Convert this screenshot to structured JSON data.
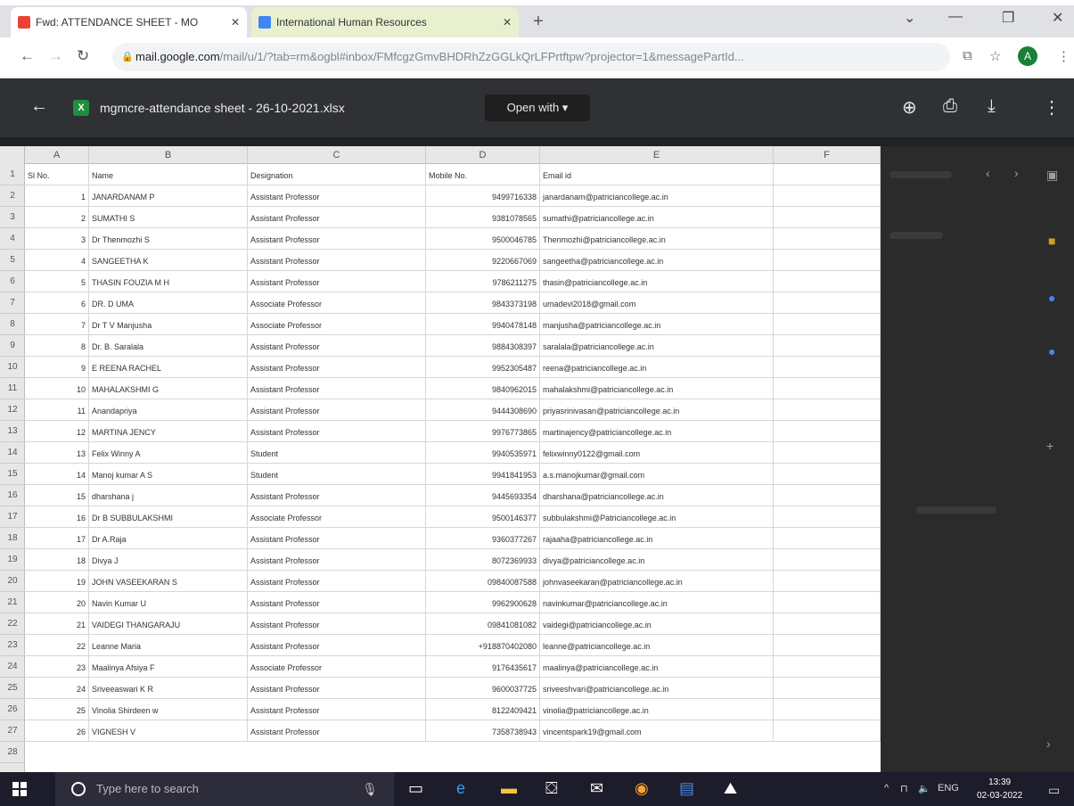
{
  "browser": {
    "tabs": [
      {
        "title": "Fwd: ATTENDANCE SHEET - MO",
        "close": "✕",
        "favicon_color": "#c5221f"
      },
      {
        "title": "International Human Resources",
        "close": "✕",
        "favicon_color": "#1a73e8"
      }
    ],
    "new_tab": "+",
    "url_host": "mail.google.com",
    "url_path": "/mail/u/1/?tab=rm&ogbl#inbox/FMfcgzGmvBHDRhZzGGLkQrLFPrtftpw?projector=1&messagePartId...",
    "avatar_letter": "A"
  },
  "viewer": {
    "file_name": "mgmcre-attendance sheet - 26-10-2021.xlsx",
    "file_icon_letter": "X",
    "open_with_label": "Open with ▾"
  },
  "sheet": {
    "columns": [
      "A",
      "B",
      "C",
      "D",
      "E",
      "F"
    ],
    "row_numbers": [
      "1",
      "2",
      "3",
      "4",
      "5",
      "6",
      "7",
      "8",
      "9",
      "10",
      "11",
      "12",
      "13",
      "14",
      "15",
      "16",
      "17",
      "18",
      "19",
      "20",
      "21",
      "22",
      "23",
      "24",
      "25",
      "26",
      "27",
      "28"
    ],
    "header": {
      "sl": "Sl No.",
      "name": "Name",
      "designation": "Designation",
      "mobile": "Mobile No.",
      "email": "Email id",
      "f": ""
    },
    "rows": [
      {
        "sl": "1",
        "name": "JANARDANAM P",
        "designation": "Assistant Professor",
        "mobile": "9499716338",
        "email": "janardanam@patriciancollege.ac.in"
      },
      {
        "sl": "2",
        "name": "SUMATHI S",
        "designation": "Assistant Professor",
        "mobile": "9381078565",
        "email": "sumathi@patriciancollege.ac.in"
      },
      {
        "sl": "3",
        "name": "Dr Thenmozhi S",
        "designation": "Assistant Professor",
        "mobile": "9500046785",
        "email": "Thenmozhi@patriciancollege.ac.in"
      },
      {
        "sl": "4",
        "name": "SANGEETHA K",
        "designation": "Assistant Professor",
        "mobile": "9220667069",
        "email": "sangeetha@patriciancollege.ac.in"
      },
      {
        "sl": "5",
        "name": "THASIN FOUZIA M H",
        "designation": "Assistant Professor",
        "mobile": "9786211275",
        "email": "thasin@patriciancollege.ac.in"
      },
      {
        "sl": "6",
        "name": "DR. D UMA",
        "designation": "Associate Professor",
        "mobile": "9843373198",
        "email": "umadevi2018@gmail.com"
      },
      {
        "sl": "7",
        "name": "Dr T V Manjusha",
        "designation": "Associate Professor",
        "mobile": "9940478148",
        "email": "manjusha@patriciancollege.ac.in"
      },
      {
        "sl": "8",
        "name": "Dr. B. Saralala",
        "designation": "Assistant Professor",
        "mobile": "9884308397",
        "email": "saralala@patriciancollege.ac.in"
      },
      {
        "sl": "9",
        "name": "E REENA RACHEL",
        "designation": "Assistant Professor",
        "mobile": "9952305487",
        "email": "reena@patriciancollege.ac.in"
      },
      {
        "sl": "10",
        "name": "MAHALAKSHMI G",
        "designation": "Assistant Professor",
        "mobile": "9840962015",
        "email": "mahalakshmi@patriciancollege.ac.in"
      },
      {
        "sl": "11",
        "name": "Anandapriya",
        "designation": "Assistant Professor",
        "mobile": "9444308690",
        "email": "priyasrinivasan@patriciancollege.ac.in"
      },
      {
        "sl": "12",
        "name": "MARTINA JENCY",
        "designation": "Assistant Professor",
        "mobile": "9976773865",
        "email": "martinajency@patriciancollege.ac.in"
      },
      {
        "sl": "13",
        "name": "Felix Winny A",
        "designation": "Student",
        "mobile": "9940535971",
        "email": "felixwinny0122@gmail.com"
      },
      {
        "sl": "14",
        "name": "Manoj kumar A S",
        "designation": "Student",
        "mobile": "9941841953",
        "email": "a.s.manojkumar@gmail.com"
      },
      {
        "sl": "15",
        "name": "dharshana j",
        "designation": "Assistant Professor",
        "mobile": "9445693354",
        "email": "dharshana@patriciancollege.ac.in"
      },
      {
        "sl": "16",
        "name": "Dr B SUBBULAKSHMI",
        "designation": "Associate Professor",
        "mobile": "9500146377",
        "email": "subbulakshmi@Patriciancollege.ac.in"
      },
      {
        "sl": "17",
        "name": "Dr A.Raja",
        "designation": "Assistant Professor",
        "mobile": "9360377267",
        "email": "rajaaha@patriciancollege.ac.in"
      },
      {
        "sl": "18",
        "name": "Divya J",
        "designation": "Assistant Professor",
        "mobile": "8072369933",
        "email": "divya@patriciancollege.ac.in"
      },
      {
        "sl": "19",
        "name": "JOHN VASEEKARAN S",
        "designation": "Assistant Professor",
        "mobile": "09840087588",
        "email": "johnvaseekaran@patriciancollege.ac.in"
      },
      {
        "sl": "20",
        "name": "Navin Kumar U",
        "designation": "Assistant Professor",
        "mobile": "9962900628",
        "email": "navinkumar@patriciancollege.ac.in"
      },
      {
        "sl": "21",
        "name": "VAIDEGI THANGARAJU",
        "designation": "Assistant Professor",
        "mobile": "09841081082",
        "email": "vaidegi@patriciancollege.ac.in"
      },
      {
        "sl": "22",
        "name": "Leanne Maria",
        "designation": "Assistant Professor",
        "mobile": "+918870402080",
        "email": "leanne@patriciancollege.ac.in"
      },
      {
        "sl": "23",
        "name": "Maalinya Afsiya F",
        "designation": "Associate Professor",
        "mobile": "9176435617",
        "email": "maalinya@patriciancollege.ac.in"
      },
      {
        "sl": "24",
        "name": "Sriveeaswari K R",
        "designation": "Assistant Professor",
        "mobile": "9600037725",
        "email": "sriveeshvari@patriciancollege.ac.in"
      },
      {
        "sl": "25",
        "name": "Vinolia Shirdeen w",
        "designation": "Assistant Professor",
        "mobile": "8122409421",
        "email": "vinolia@patriciancollege.ac.in"
      },
      {
        "sl": "26",
        "name": "VIGNESH V",
        "designation": "Assistant Professor",
        "mobile": "7358738943",
        "email": "vincentspark19@gmail.com"
      }
    ]
  },
  "taskbar": {
    "search_placeholder": "Type here to search",
    "time": "13:39",
    "date": "02-03-2022",
    "lang": "ENG"
  }
}
